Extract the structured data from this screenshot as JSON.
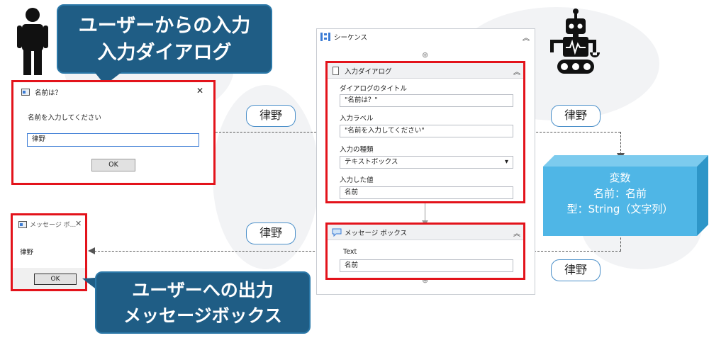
{
  "callout_top": {
    "line1": "ユーザーからの入力",
    "line2": "入力ダイアログ"
  },
  "callout_bottom": {
    "line1": "ユーザーへの出力",
    "line2": "メッセージボックス"
  },
  "input_window": {
    "title": "名前は？",
    "close_glyph": "✕",
    "prompt": "名前を入力してください",
    "value": "律野",
    "ok_label": "OK"
  },
  "msg_window": {
    "title": "メッセージ ボ...",
    "close_glyph": "✕",
    "text": "律野",
    "ok_label": "OK"
  },
  "sequence": {
    "title": "シーケンス",
    "collapse": "︽",
    "plus": "⊕",
    "input_activity": {
      "title": "入力ダイアログ",
      "collapse": "︽",
      "dialog_title_label": "ダイアログのタイトル",
      "dialog_title_value": "\"名前は？\"",
      "input_label_label": "入力ラベル",
      "input_label_value": "\"名前を入力してください\"",
      "input_type_label": "入力の種類",
      "input_type_value": "テキストボックス",
      "dropdown_arrow": "▾",
      "entered_value_label": "入力した値",
      "entered_value_value": "名前"
    },
    "msgbox_activity": {
      "title": "メッセージ ボックス",
      "collapse": "︽",
      "text_label": "Text",
      "text_value": "名前"
    }
  },
  "bubbles": {
    "b1": "律野",
    "b2": "律野",
    "b3": "律野",
    "b4": "律野"
  },
  "variable_box": {
    "title": "変数",
    "name_line": "名前：名前",
    "type_line": "型：String（文字列）"
  },
  "colors": {
    "callout_bg": "#1f5d85",
    "red_frame": "#e3131b",
    "variable_box": "#4fb6e6",
    "bubble_border": "#4a8fc9"
  },
  "icons": {
    "person": "person-icon",
    "robot": "robot-icon"
  }
}
